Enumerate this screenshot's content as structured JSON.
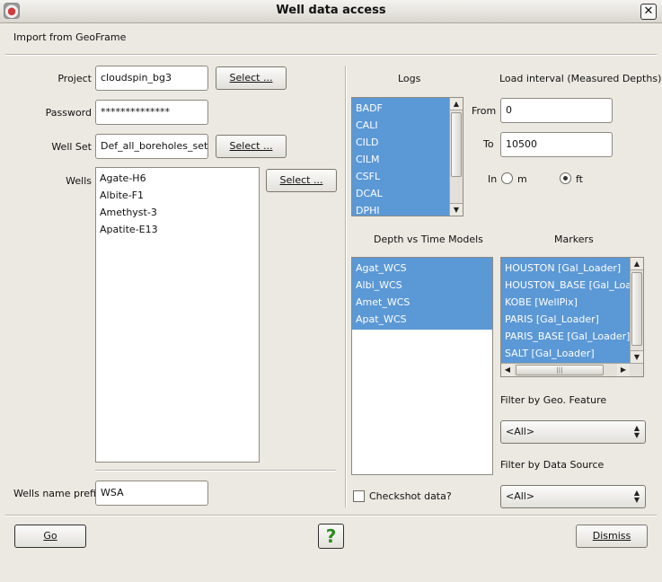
{
  "window": {
    "title": "Well data access",
    "close_glyph": "✕"
  },
  "section_title": "Import from GeoFrame",
  "project": {
    "label": "Project",
    "value": "cloudspin_bg3",
    "select_label": "Select ..."
  },
  "password": {
    "label": "Password",
    "value": "**************"
  },
  "well_set": {
    "label": "Well Set",
    "value": "Def_all_boreholes_set",
    "select_label": "Select ..."
  },
  "wells": {
    "label": "Wells",
    "items": [
      "Agate-H6",
      "Albite-F1",
      "Amethyst-3",
      "Apatite-E13"
    ],
    "select_label": "Select ..."
  },
  "wells_prefix": {
    "label": "Wells name prefix",
    "value": "WSA"
  },
  "logs": {
    "label": "Logs",
    "items": [
      "BADF",
      "CALI",
      "CILD",
      "CILM",
      "CSFL",
      "DCAL",
      "DPHI"
    ]
  },
  "load_interval": {
    "label": "Load interval (Measured Depths)",
    "from_label": "From",
    "from_value": "0",
    "to_label": "To",
    "to_value": "10500",
    "in_label": "In",
    "unit_m": "m",
    "unit_ft": "ft",
    "selected_unit": "ft"
  },
  "depth_time": {
    "label": "Depth vs Time Models",
    "items": [
      "Agat_WCS",
      "Albi_WCS",
      "Amet_WCS",
      "Apat_WCS"
    ]
  },
  "markers": {
    "label": "Markers",
    "items": [
      "HOUSTON [Gal_Loader]",
      "HOUSTON_BASE [Gal_Loader]",
      "KOBE [WellPix]",
      "PARIS [Gal_Loader]",
      "PARIS_BASE [Gal_Loader]",
      "SALT [Gal_Loader]"
    ]
  },
  "filter_geo": {
    "label": "Filter by Geo. Feature",
    "value": "<All>"
  },
  "filter_source": {
    "label": "Filter by Data Source",
    "value": "<All>"
  },
  "checkshot": {
    "label": "Checkshot data?",
    "checked": false
  },
  "footer": {
    "go_label": "Go",
    "help_glyph": "?",
    "dismiss_label": "Dismiss"
  },
  "colors": {
    "selection": "#5b98d6",
    "window_bg": "#ece9e2",
    "help_icon": "#2a8a1e"
  }
}
